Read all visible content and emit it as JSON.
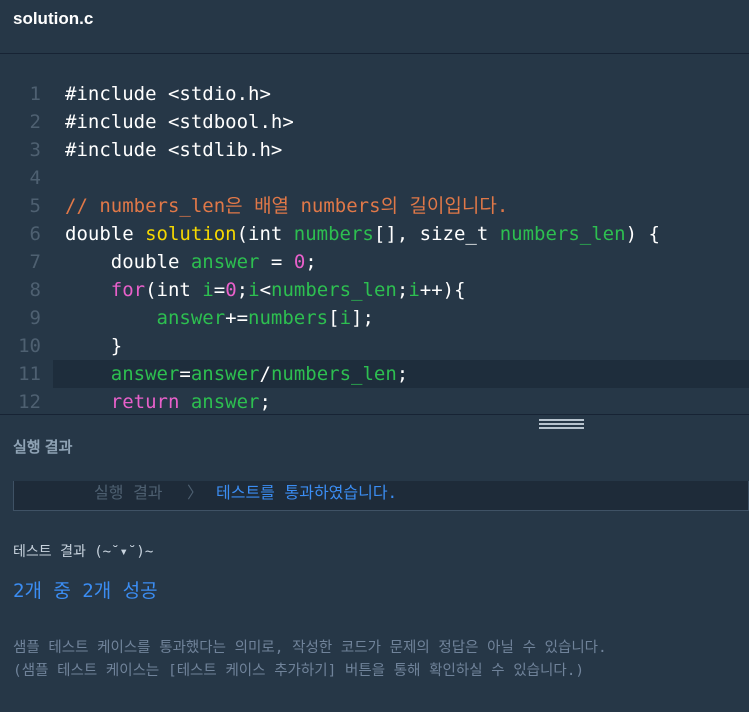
{
  "header": {
    "file_name": "solution.c"
  },
  "editor": {
    "active_line": 11,
    "lines": [
      {
        "n": "1",
        "tokens": [
          {
            "t": "#include <stdio.h>",
            "c": "plain"
          }
        ]
      },
      {
        "n": "2",
        "tokens": [
          {
            "t": "#include <stdbool.h>",
            "c": "plain"
          }
        ]
      },
      {
        "n": "3",
        "tokens": [
          {
            "t": "#include <stdlib.h>",
            "c": "plain"
          }
        ]
      },
      {
        "n": "4",
        "tokens": []
      },
      {
        "n": "5",
        "tokens": [
          {
            "t": "// numbers_len은 배열 numbers의 길이입니다.",
            "c": "cm"
          }
        ]
      },
      {
        "n": "6",
        "tokens": [
          {
            "t": "double ",
            "c": "plain"
          },
          {
            "t": "solution",
            "c": "fn"
          },
          {
            "t": "(int ",
            "c": "plain"
          },
          {
            "t": "numbers",
            "c": "var"
          },
          {
            "t": "[], size_t ",
            "c": "plain"
          },
          {
            "t": "numbers_len",
            "c": "var"
          },
          {
            "t": ") {",
            "c": "plain"
          }
        ]
      },
      {
        "n": "7",
        "tokens": [
          {
            "t": "    double ",
            "c": "plain"
          },
          {
            "t": "answer",
            "c": "var"
          },
          {
            "t": " = ",
            "c": "plain"
          },
          {
            "t": "0",
            "c": "num"
          },
          {
            "t": ";",
            "c": "plain"
          }
        ]
      },
      {
        "n": "8",
        "tokens": [
          {
            "t": "    ",
            "c": "plain"
          },
          {
            "t": "for",
            "c": "kw"
          },
          {
            "t": "(int ",
            "c": "plain"
          },
          {
            "t": "i",
            "c": "var"
          },
          {
            "t": "=",
            "c": "plain"
          },
          {
            "t": "0",
            "c": "num"
          },
          {
            "t": ";",
            "c": "plain"
          },
          {
            "t": "i",
            "c": "var"
          },
          {
            "t": "<",
            "c": "plain"
          },
          {
            "t": "numbers_len",
            "c": "var"
          },
          {
            "t": ";",
            "c": "plain"
          },
          {
            "t": "i",
            "c": "var"
          },
          {
            "t": "++){",
            "c": "plain"
          }
        ]
      },
      {
        "n": "9",
        "tokens": [
          {
            "t": "        ",
            "c": "plain"
          },
          {
            "t": "answer",
            "c": "var"
          },
          {
            "t": "+=",
            "c": "plain"
          },
          {
            "t": "numbers",
            "c": "var"
          },
          {
            "t": "[",
            "c": "plain"
          },
          {
            "t": "i",
            "c": "var"
          },
          {
            "t": "];",
            "c": "plain"
          }
        ]
      },
      {
        "n": "10",
        "tokens": [
          {
            "t": "    }",
            "c": "plain"
          }
        ]
      },
      {
        "n": "11",
        "tokens": [
          {
            "t": "    ",
            "c": "plain"
          },
          {
            "t": "answer",
            "c": "var"
          },
          {
            "t": "=",
            "c": "plain"
          },
          {
            "t": "answer",
            "c": "var"
          },
          {
            "t": "/",
            "c": "plain"
          },
          {
            "t": "numbers_len",
            "c": "var"
          },
          {
            "t": ";",
            "c": "plain"
          }
        ]
      },
      {
        "n": "12",
        "tokens": [
          {
            "t": "    ",
            "c": "plain"
          },
          {
            "t": "return",
            "c": "kw"
          },
          {
            "t": " ",
            "c": "plain"
          },
          {
            "t": "answer",
            "c": "var"
          },
          {
            "t": ";",
            "c": "plain"
          }
        ]
      }
    ]
  },
  "result": {
    "title": "실행 결과",
    "bar_label": "실행 결과",
    "bar_separator": "〉",
    "bar_message": "테스트를 통과하였습니다.",
    "test_heading": "테스트 결과 (~˘▾˘)~",
    "test_summary": "2개 중 2개 성공",
    "note_line1": "샘플 테스트 케이스를 통과했다는 의미로, 작성한 코드가 문제의 정답은 아닐 수 있습니다.",
    "note_line2": "(샘플 테스트 케이스는 [테스트 케이스 추가하기] 버튼을 통해 확인하실 수 있습니다.)"
  },
  "colors": {
    "background": "#263747",
    "keyword": "#e860ca",
    "function": "#f5d800",
    "variable": "#2dbf50",
    "comment": "#e07848",
    "success": "#3b8df3"
  }
}
